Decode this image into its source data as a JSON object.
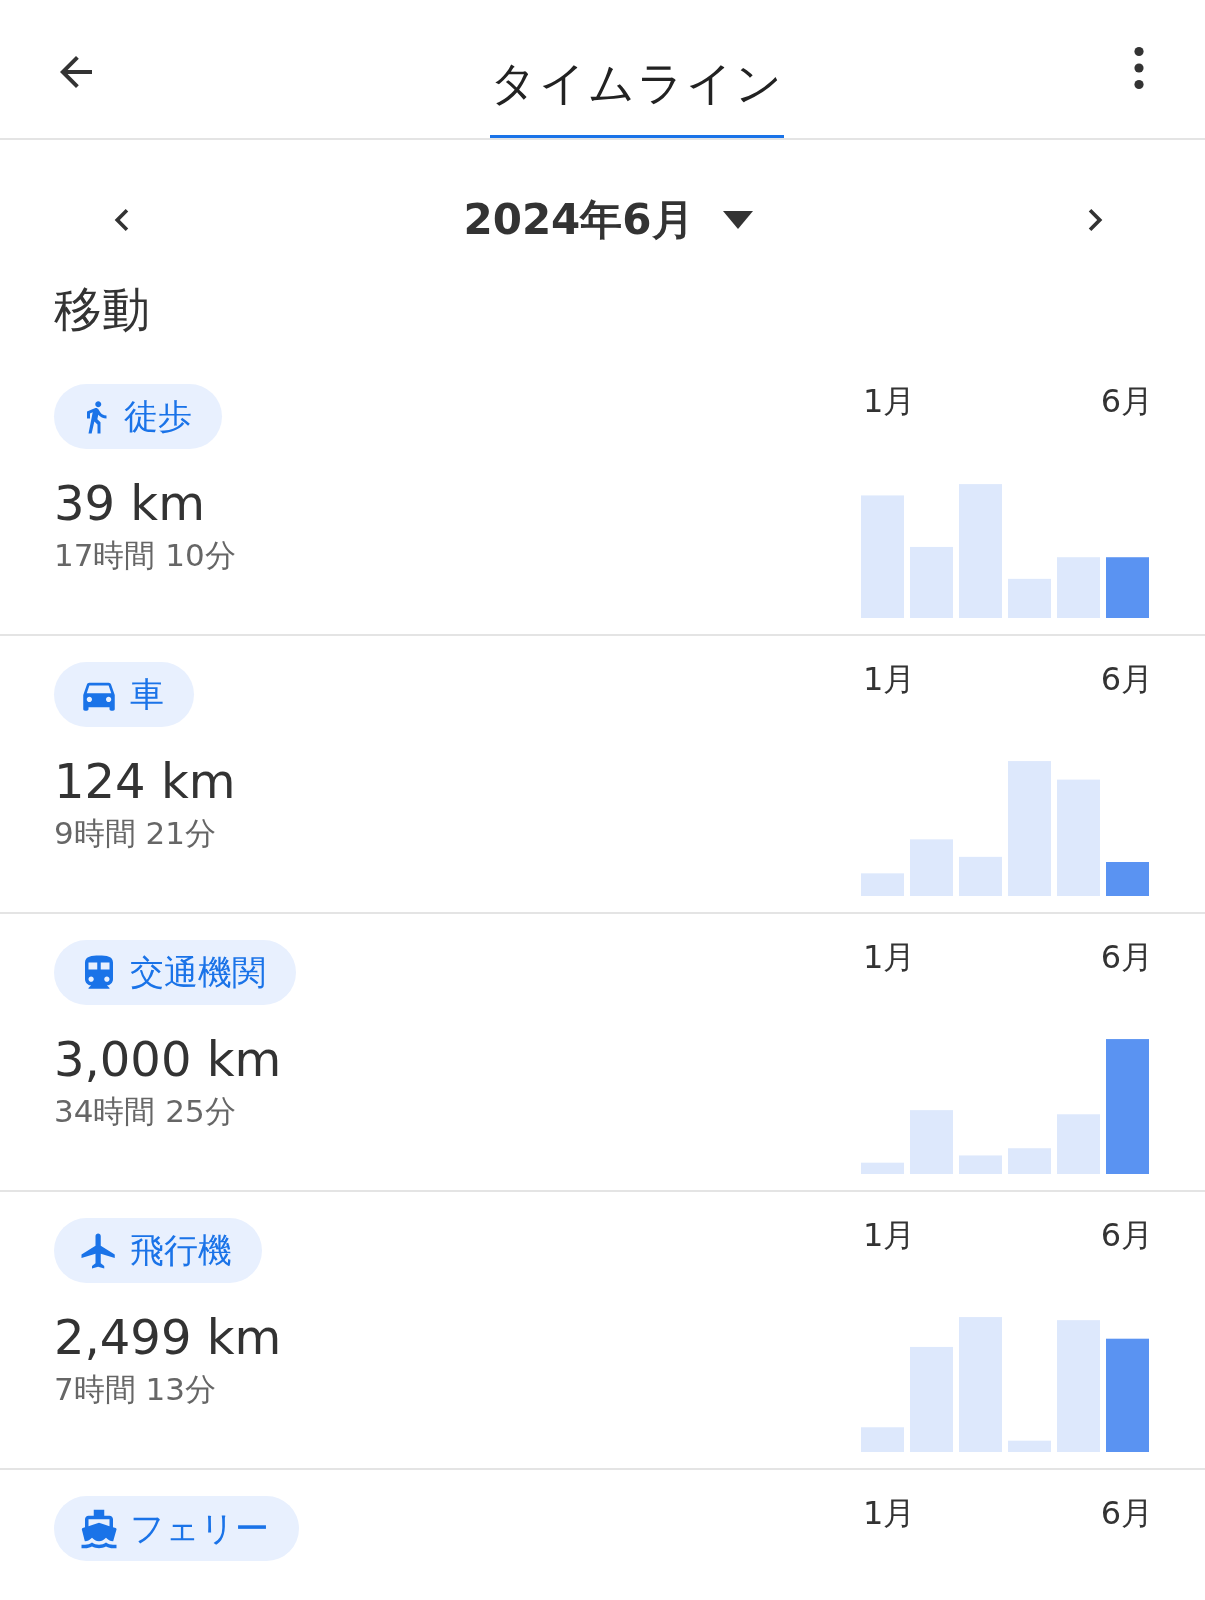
{
  "header": {
    "title": "タイムライン"
  },
  "month_nav": {
    "label": "2024年6月"
  },
  "section_title": "移動",
  "activities": [
    {
      "kind": "walk",
      "label": "徒歩",
      "distance": "39 km",
      "duration": "17時間 10分",
      "start_label": "1月",
      "end_label": "6月"
    },
    {
      "kind": "car",
      "label": "車",
      "distance": "124 km",
      "duration": "9時間 21分",
      "start_label": "1月",
      "end_label": "6月"
    },
    {
      "kind": "transit",
      "label": "交通機関",
      "distance": "3,000 km",
      "duration": "34時間 25分",
      "start_label": "1月",
      "end_label": "6月"
    },
    {
      "kind": "flight",
      "label": "飛行機",
      "distance": "2,499 km",
      "duration": "7時間 13分",
      "start_label": "1月",
      "end_label": "6月"
    },
    {
      "kind": "ferry",
      "label": "フェリー",
      "start_label": "1月",
      "end_label": "6月"
    }
  ]
}
